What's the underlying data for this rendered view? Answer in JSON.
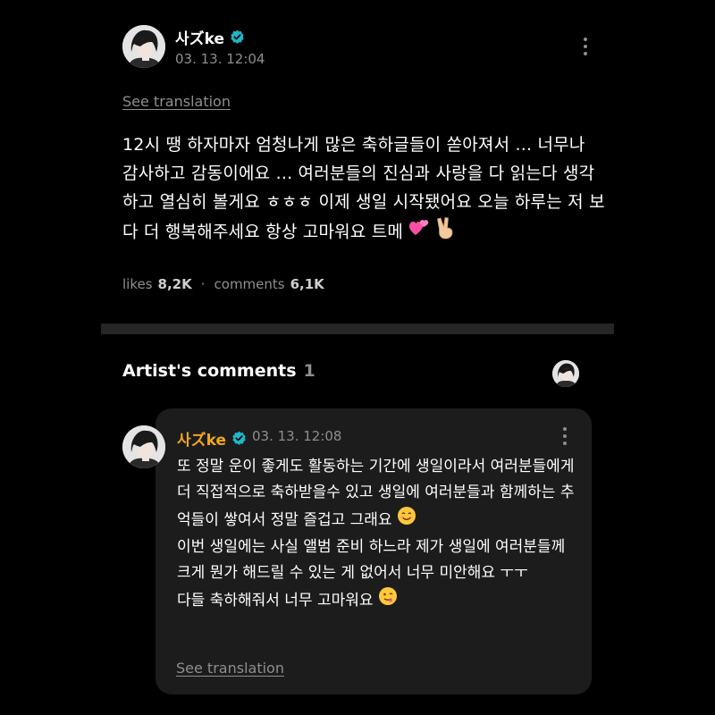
{
  "post": {
    "author": "사ズke",
    "date": "03. 13. 12:04",
    "see_translation": "See translation",
    "body": "12시 땡 하자마자 엄청나게 많은 축하글들이 쏟아져서 ... 너무나 감사하고 감동이에요 ... 여러분들의 진심과 사랑을 다 읽는다 생각하고 열심히 볼게요 ㅎㅎㅎ 이제 생일 시작됐어요 오늘 하루는 저 보다 더 행복해주세요 항상 고마워요 트메",
    "likes_label": "likes",
    "likes_count": "8,2K",
    "separator": "·",
    "comments_label": "comments",
    "comments_count": "6,1K"
  },
  "artist_comments": {
    "title": "Artist's comments",
    "count": "1"
  },
  "comment": {
    "author": "사ズke",
    "date": "03. 13. 12:08",
    "lines": [
      "또 정말 운이 좋게도 활동하는 기간에 생일이라서 여러분들에게 더 직접적으로 축하받을수 있고 생일에 여러분들과 함께하는 추억들이 쌓여서 정말 즐겁고 그래요",
      "이번 생일에는 사실 앨범 준비 하느라 제가 생일에 여러분들께 크게 뭔가 해드릴 수 있는 게 없어서 너무 미안해요 ㅜㅜ",
      "다들 축하해줘서 너무 고마워요"
    ],
    "see_translation": "See translation"
  },
  "colors": {
    "background": "#000000",
    "card": "#1c1c1c",
    "divider": "#262626",
    "muted": "#8e8e8e",
    "verified": "#1fb6c9",
    "artist_name_in_comment": "#f0a71e"
  },
  "icons": {
    "verified": "verified-badge-icon",
    "more": "kebab-menu-icon",
    "heart_emoji": "two-hearts-emoji",
    "peace_emoji": "victory-hand-emoji",
    "smile_emoji": "smiling-face-emoji",
    "kiss_emoji": "face-savoring-emoji"
  }
}
